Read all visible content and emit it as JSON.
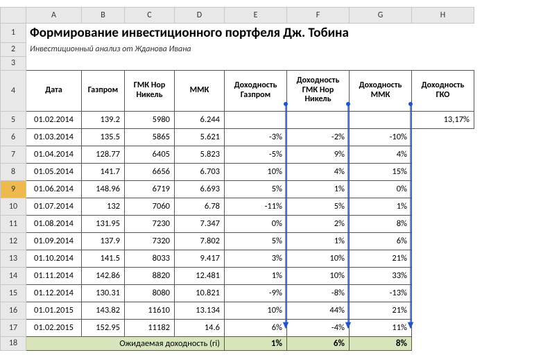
{
  "columns": [
    "A",
    "B",
    "C",
    "D",
    "E",
    "F",
    "G",
    "H"
  ],
  "title": "Формирование инвестиционного портфеля Дж. Тобина",
  "subtitle": "Инвестиционный анализ от Жданова Ивана",
  "headers": {
    "date": "Дата",
    "gazprom": "Газпром",
    "gmk": "ГМК Нор Никель",
    "mmk": "ММК",
    "ret_gazprom": "Доходность Газпром",
    "ret_gmk": "Доходность ГМК Нор Никель",
    "ret_mmk": "Доходность ММК",
    "ret_gko": "Доходность ГКО"
  },
  "gko_value": "13,17%",
  "rows": [
    {
      "n": "5",
      "date": "01.02.2014",
      "gaz": "139.2",
      "gmk": "5980",
      "mmk": "6.244",
      "rg": "",
      "rgm": "",
      "rm": ""
    },
    {
      "n": "6",
      "date": "01.03.2014",
      "gaz": "135.5",
      "gmk": "5865",
      "mmk": "5.621",
      "rg": "-3%",
      "rgm": "-2%",
      "rm": "-10%"
    },
    {
      "n": "7",
      "date": "01.04.2014",
      "gaz": "128.77",
      "gmk": "6405",
      "mmk": "5.823",
      "rg": "-5%",
      "rgm": "9%",
      "rm": "4%"
    },
    {
      "n": "8",
      "date": "01.05.2014",
      "gaz": "141.7",
      "gmk": "6656",
      "mmk": "6.703",
      "rg": "10%",
      "rgm": "4%",
      "rm": "15%"
    },
    {
      "n": "9",
      "date": "01.06.2014",
      "gaz": "148.96",
      "gmk": "6719",
      "mmk": "6.693",
      "rg": "5%",
      "rgm": "1%",
      "rm": "0%"
    },
    {
      "n": "10",
      "date": "01.07.2014",
      "gaz": "132",
      "gmk": "7060",
      "mmk": "6.78",
      "rg": "-11%",
      "rgm": "5%",
      "rm": "1%"
    },
    {
      "n": "11",
      "date": "01.08.2014",
      "gaz": "131.95",
      "gmk": "7230",
      "mmk": "7.347",
      "rg": "0%",
      "rgm": "2%",
      "rm": "8%"
    },
    {
      "n": "12",
      "date": "01.09.2014",
      "gaz": "137.9",
      "gmk": "7320",
      "mmk": "7.802",
      "rg": "5%",
      "rgm": "1%",
      "rm": "6%"
    },
    {
      "n": "13",
      "date": "01.10.2014",
      "gaz": "141.5",
      "gmk": "8033",
      "mmk": "9.417",
      "rg": "3%",
      "rgm": "10%",
      "rm": "21%"
    },
    {
      "n": "14",
      "date": "01.11.2014",
      "gaz": "142.86",
      "gmk": "8820",
      "mmk": "12.481",
      "rg": "1%",
      "rgm": "10%",
      "rm": "33%"
    },
    {
      "n": "15",
      "date": "01.12.2014",
      "gaz": "130.31",
      "gmk": "8080",
      "mmk": "10.821",
      "rg": "-9%",
      "rgm": "-8%",
      "rm": "-13%"
    },
    {
      "n": "16",
      "date": "01.01.2015",
      "gaz": "143.82",
      "gmk": "11610",
      "mmk": "13.134",
      "rg": "10%",
      "rgm": "44%",
      "rm": "21%"
    },
    {
      "n": "17",
      "date": "01.02.2015",
      "gaz": "152.95",
      "gmk": "11182",
      "mmk": "14.6",
      "rg": "6%",
      "rgm": "-4%",
      "rm": "11%"
    }
  ],
  "summary": {
    "row_num": "18",
    "label": "Ожидаемая доходность (ri)",
    "e": "1%",
    "f": "6%",
    "g": "8%"
  }
}
